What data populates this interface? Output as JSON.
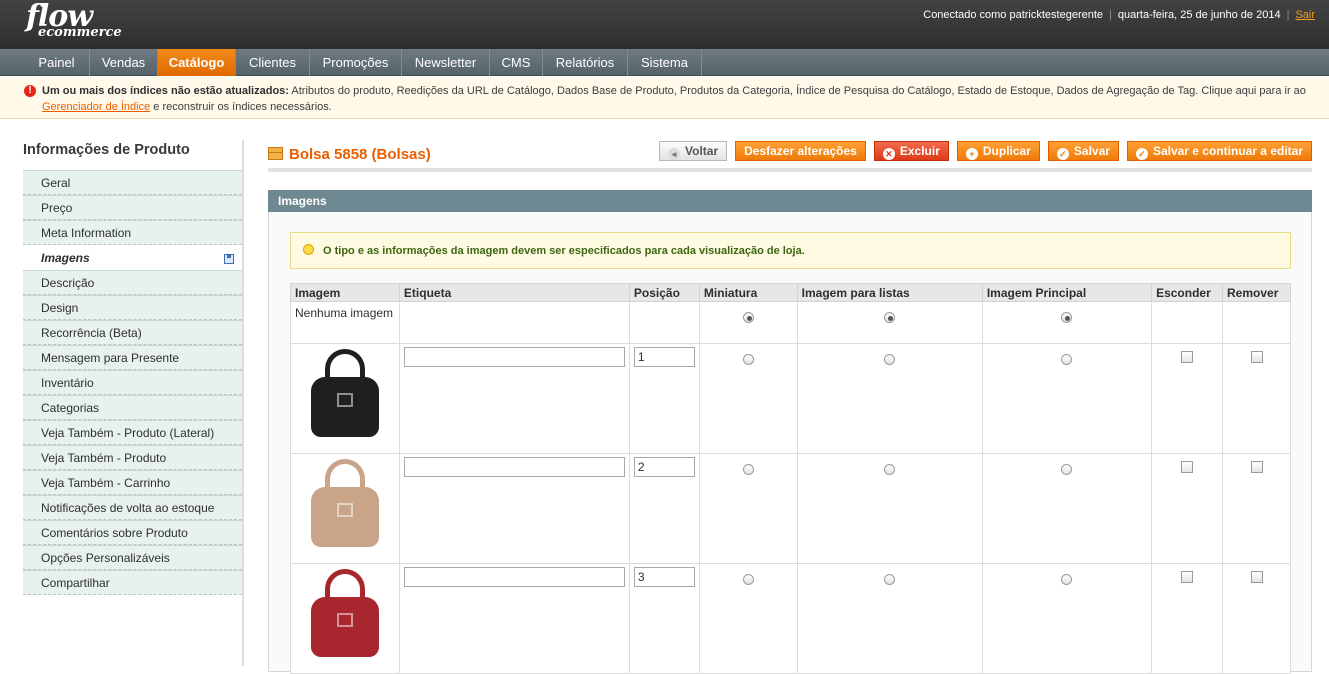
{
  "header": {
    "logo_line1": "flow",
    "logo_line2": "ecommerce",
    "connected": "Conectado como patricktestegerente",
    "date": "quarta-feira, 25 de junho de 2014",
    "logout": "Sair"
  },
  "nav": [
    "Painel",
    "Vendas",
    "Catálogo",
    "Clientes",
    "Promoções",
    "Newsletter",
    "CMS",
    "Relatórios",
    "Sistema"
  ],
  "nav_active": "Catálogo",
  "notice": {
    "bold": "Um ou mais dos índices não estão atualizados:",
    "text": " Atributos do produto, Reedições da URL de Catálogo, Dados Base de Produto, Produtos da Categoria, Índice de Pesquisa do Catálogo, Estado de Estoque, Dados de Agregação de Tag. Clique aqui para ir ao ",
    "link": "Gerenciador de Índice",
    "tail": " e reconstruir os índices necessários."
  },
  "sidebar": {
    "title": "Informações de Produto",
    "items": [
      "Geral",
      "Preço",
      "Meta Information",
      "Imagens",
      "Descrição",
      "Design",
      "Recorrência (Beta)",
      "Mensagem para Presente",
      "Inventário",
      "Categorias",
      "Veja Também - Produto (Lateral)",
      "Veja Também - Produto",
      "Veja Também - Carrinho",
      "Notificações de volta ao estoque",
      "Comentários sobre Produto",
      "Opções Personalizáveis",
      "Compartilhar"
    ],
    "active": "Imagens"
  },
  "product": {
    "title": "Bolsa 5858 (Bolsas)"
  },
  "buttons": {
    "back": "Voltar",
    "reset": "Desfazer alterações",
    "delete": "Excluir",
    "duplicate": "Duplicar",
    "save": "Salvar",
    "save_continue": "Salvar e continuar a editar"
  },
  "section": {
    "title": "Imagens",
    "tip": "O tipo e as informações da imagem devem ser especificados para cada visualização de loja."
  },
  "table": {
    "headers": [
      "Imagem",
      "Etiqueta",
      "Posição",
      "Miniatura",
      "Imagem para listas",
      "Imagem Principal",
      "Esconder",
      "Remover"
    ],
    "no_image": "Nenhuma imagem",
    "rows": [
      {
        "label": "",
        "position": "1",
        "color": "#1f1f1f"
      },
      {
        "label": "",
        "position": "2",
        "color": "#c9a488"
      },
      {
        "label": "",
        "position": "3",
        "color": "#a8262d"
      }
    ]
  },
  "colors": {
    "accent": "#eb5e00",
    "nav_bg": "#5f6c73",
    "section_head": "#6f8992"
  }
}
